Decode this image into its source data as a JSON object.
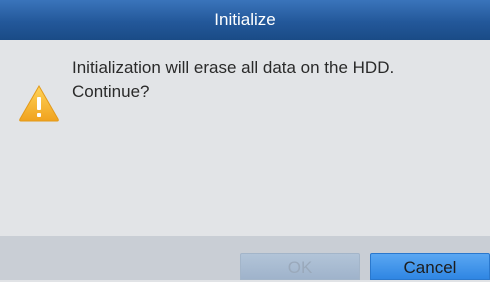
{
  "dialog": {
    "title": "Initialize",
    "message_line1": "Initialization will erase all data on the HDD.",
    "message_line2": "Continue?",
    "icon": "warning-icon",
    "ok_label": "OK",
    "ok_enabled": false,
    "cancel_label": "Cancel"
  },
  "colors": {
    "titlebar": "#23589a",
    "body": "#e2e4e7",
    "footer": "#c9ced5",
    "ok_disabled": "#a6b8ce",
    "cancel_button": "#3b8fe8",
    "warning": "#f3b431"
  }
}
